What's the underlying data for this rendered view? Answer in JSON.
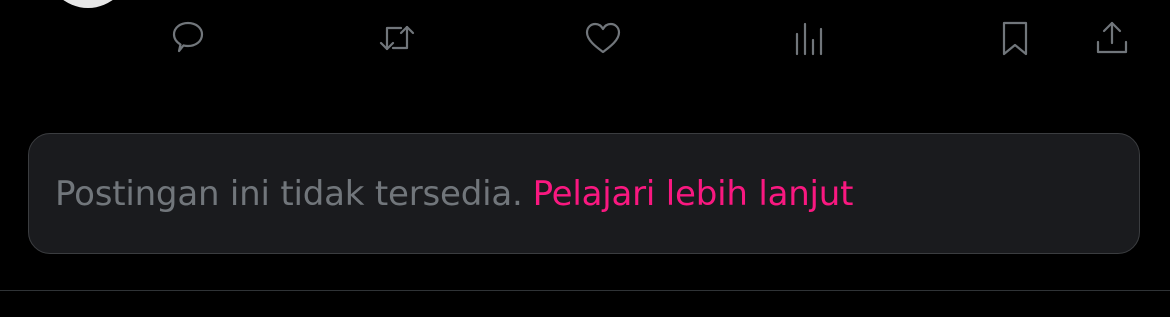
{
  "post": {
    "actions": [
      {
        "id": "reply",
        "icon": "reply-icon"
      },
      {
        "id": "repost",
        "icon": "repost-icon"
      },
      {
        "id": "like",
        "icon": "heart-icon"
      },
      {
        "id": "views",
        "icon": "analytics-icon"
      },
      {
        "id": "bookmark",
        "icon": "bookmark-icon"
      },
      {
        "id": "share",
        "icon": "share-icon"
      }
    ]
  },
  "notice": {
    "text": "Postingan ini tidak tersedia.",
    "link_label": "Pelajari lebih lanjut"
  },
  "colors": {
    "background": "#000000",
    "icon": "#71767b",
    "notice_background": "#1a1b1e",
    "notice_text": "#71767b",
    "link": "#f91880"
  }
}
